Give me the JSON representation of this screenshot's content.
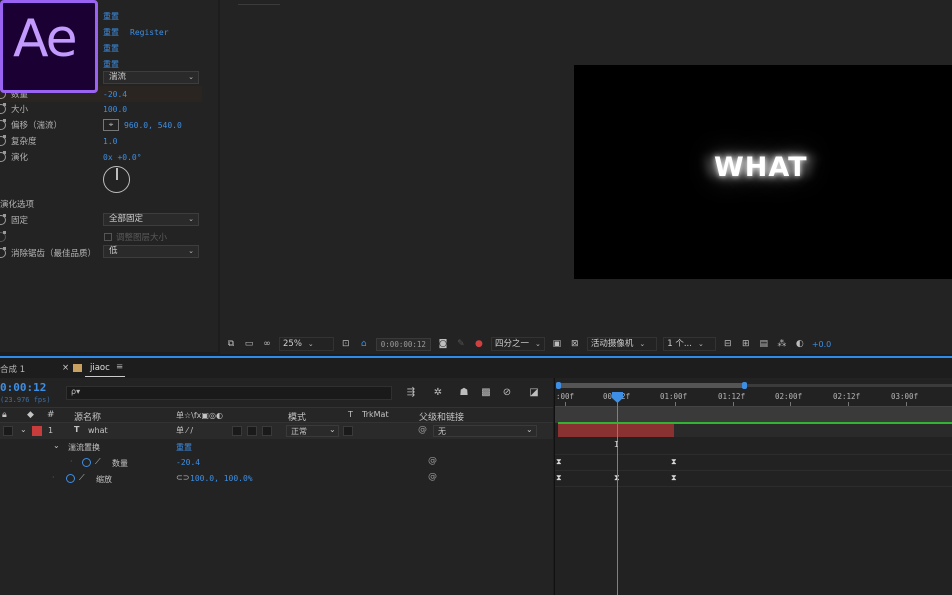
{
  "effects": {
    "reset_rows": [
      "重置",
      "重置",
      "重置",
      "重置"
    ],
    "register": "Register",
    "turbulent_dropdown": "湍流",
    "props": [
      {
        "name": "数量",
        "value": "-20.4"
      },
      {
        "name": "大小",
        "value": "100.0"
      },
      {
        "name": "偏移（湍流）",
        "value": "960.0, 540.0"
      },
      {
        "name": "复杂度",
        "value": "1.0"
      },
      {
        "name": "演化",
        "value": "0x +0.0°"
      }
    ],
    "evolution_options_label": "演化选项",
    "pin_label": "固定",
    "pin_value": "全部固定",
    "resize_layer_label": "调整图层大小",
    "antialias_label": "消除锯齿（最佳品质）",
    "antialias_value": "低"
  },
  "viewer": {
    "comp_text": "WHAT",
    "zoom": "25%",
    "timecode": "0:00:00:12",
    "resolution": "四分之一",
    "camera": "活动摄像机",
    "views": "1 个...",
    "exposure": "+0.0"
  },
  "timeline": {
    "tabs": [
      {
        "label": "合成 1"
      },
      {
        "label": "jiaoc"
      }
    ],
    "current_time": "0:00:12",
    "fps": "(23.976 fps)",
    "search_icon_text": "ρ▾",
    "headers": {
      "source_name": "源名称",
      "switches": "单☆\\fx▣◎◐",
      "mode": "模式",
      "t": "T",
      "trkmat": "TrkMat",
      "parent": "父级和链接"
    },
    "layer": {
      "index": "1",
      "type": "T",
      "name": "what",
      "mode": "正常",
      "parent": "无",
      "label_color": "#c83c3c"
    },
    "effect_group": {
      "name": "湍流置换",
      "reset": "重置"
    },
    "prop_amount": {
      "name": "数量",
      "value": "-20.4"
    },
    "prop_scale": {
      "name": "缩放",
      "value": "100.0, 100.0%"
    },
    "ruler_labels": [
      ":00f",
      "00:12f",
      "01:00f",
      "01:12f",
      "02:00f",
      "02:12f",
      "03:00f"
    ],
    "keyframe_glyph": "⧗"
  },
  "colors": {
    "accent": "#3d8fe6",
    "layer_bar": "#8a3232",
    "green_line": "#32b432"
  }
}
